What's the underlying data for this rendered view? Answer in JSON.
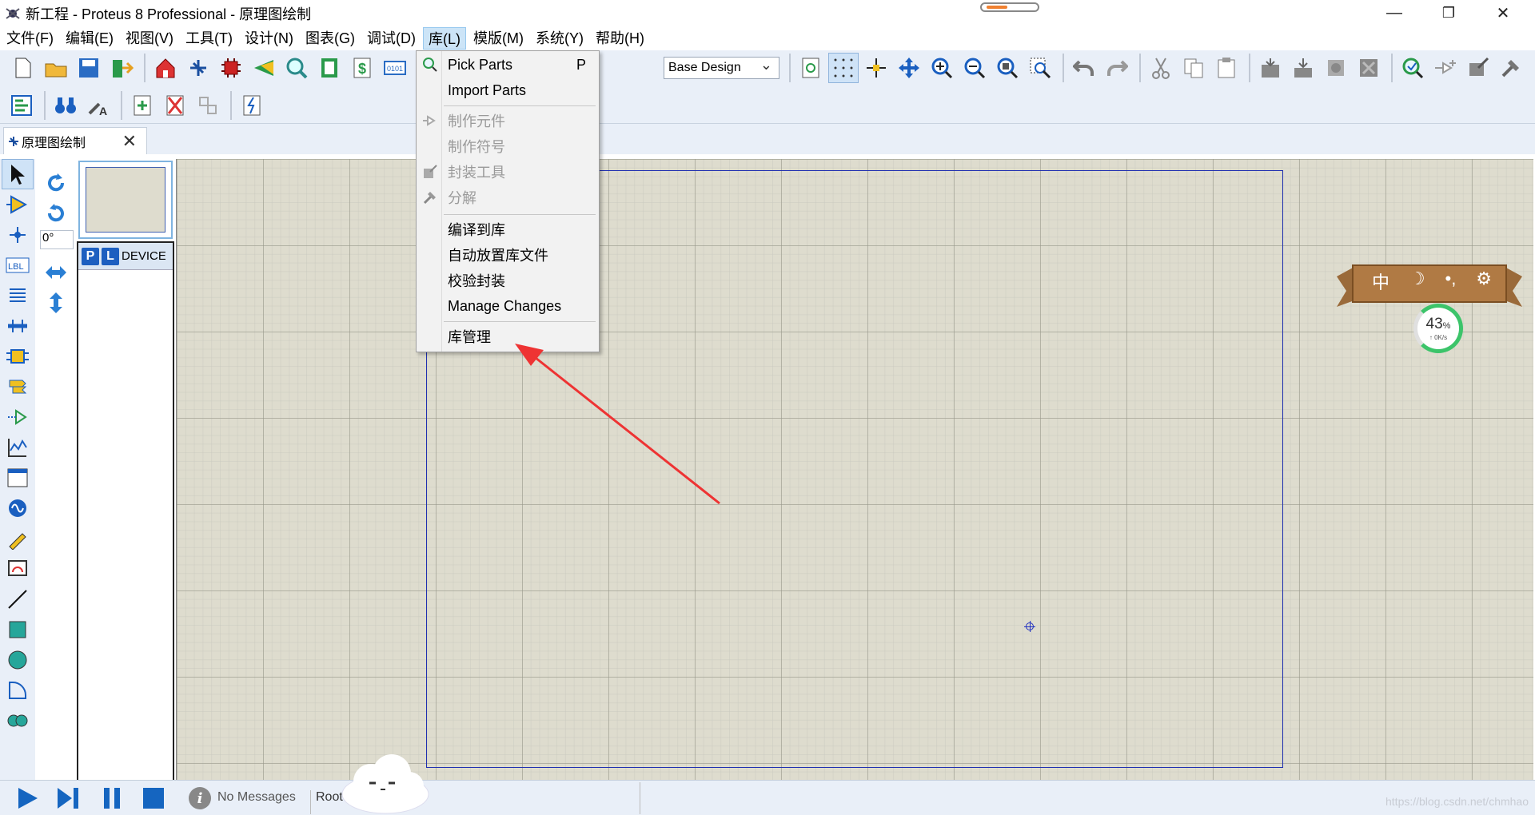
{
  "window": {
    "title": "新工程 - Proteus 8 Professional - 原理图绘制",
    "minimize": "—",
    "restore": "❐",
    "close": "✕"
  },
  "menu": [
    "文件(F)",
    "编辑(E)",
    "视图(V)",
    "工具(T)",
    "设计(N)",
    "图表(G)",
    "调试(D)",
    "库(L)",
    "模版(M)",
    "系统(Y)",
    "帮助(H)"
  ],
  "toolbar": {
    "design_select": "Base Design"
  },
  "tab": {
    "label": "原理图绘制",
    "close": "✕"
  },
  "left_panel": {
    "angle": "0°",
    "p_button": "P",
    "l_button": "L",
    "devices_label": "DEVICES"
  },
  "library_menu": {
    "items": [
      {
        "label": "Pick Parts",
        "shortcut": "P",
        "enabled": true
      },
      {
        "label": "Import Parts",
        "shortcut": "",
        "enabled": true
      },
      {
        "label": "制作元件",
        "shortcut": "",
        "enabled": false
      },
      {
        "label": "制作符号",
        "shortcut": "",
        "enabled": false
      },
      {
        "label": "封装工具",
        "shortcut": "",
        "enabled": false
      },
      {
        "label": "分解",
        "shortcut": "",
        "enabled": false
      },
      {
        "label": "编译到库",
        "shortcut": "",
        "enabled": true
      },
      {
        "label": "自动放置库文件",
        "shortcut": "",
        "enabled": true
      },
      {
        "label": "校验封装",
        "shortcut": "",
        "enabled": true
      },
      {
        "label": "Manage Changes",
        "shortcut": "",
        "enabled": true
      },
      {
        "label": "库管理",
        "shortcut": "",
        "enabled": true
      }
    ]
  },
  "widget": {
    "labels": [
      "中",
      "☽",
      "•,",
      "⚙"
    ],
    "percent": "43",
    "percent_unit": "%",
    "speed": "↑ 0K/s"
  },
  "status": {
    "messages": "No Messages",
    "root": "Root",
    "watermark": "https://blog.csdn.net/chmhao"
  },
  "colors": {
    "canvas": "#dedcce",
    "sheet_border": "#2030b0",
    "menu_active": "#cce4f7",
    "annotation_arrow": "#ee3333"
  }
}
